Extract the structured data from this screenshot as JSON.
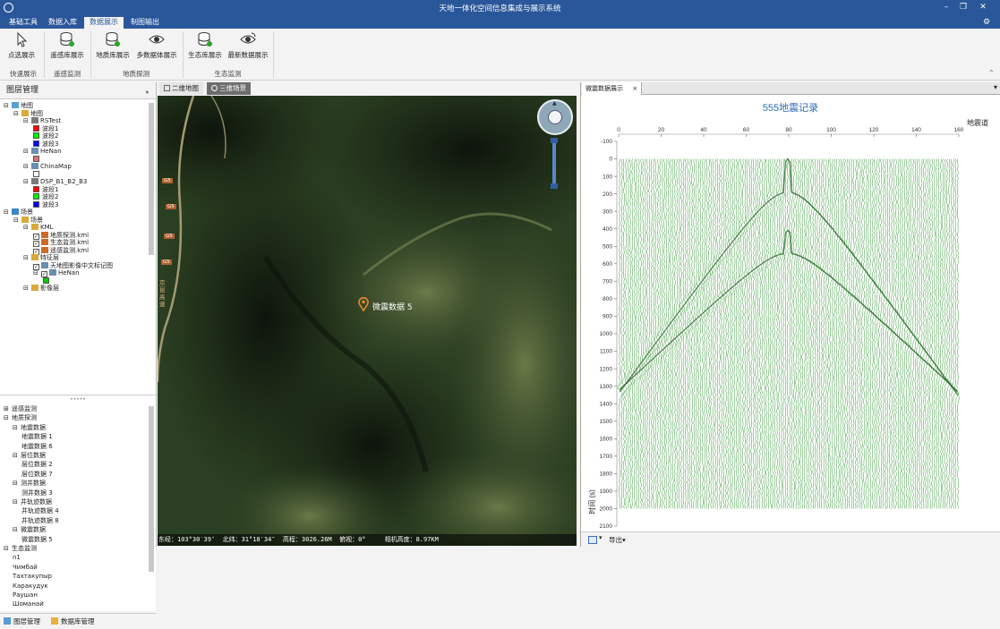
{
  "titlebar": {
    "title": "天地一体化空间信息集成与展示系统"
  },
  "ribbon_tabs": [
    "基础工具",
    "数据入库",
    "数据展示",
    "制图输出"
  ],
  "ribbon": {
    "buttons": [
      "点选展示",
      "遥感库展示",
      "地质库展示",
      "多数据体展示",
      "生态库展示",
      "最新数据展示"
    ],
    "groups": [
      "快速展示",
      "遥感监测",
      "地质探测",
      "生态监测"
    ]
  },
  "left_panel": {
    "title": "图层管理",
    "pin": "ᵩ"
  },
  "layer_tree": [
    {
      "d": 0,
      "exp": "⊟",
      "text": "地图",
      "icon": "map"
    },
    {
      "d": 1,
      "exp": "⊟",
      "text": "地图",
      "icon": "folder"
    },
    {
      "d": 2,
      "exp": "⊟",
      "text": "RSTest",
      "icon": "grid"
    },
    {
      "d": 3,
      "text": "波段1",
      "sw": "#ff0000"
    },
    {
      "d": 3,
      "text": "波段2",
      "sw": "#00ee00"
    },
    {
      "d": 3,
      "text": "波段3",
      "sw": "#0000ff"
    },
    {
      "d": 2,
      "exp": "⊟",
      "text": "HeNan",
      "icon": "vec"
    },
    {
      "d": 3,
      "text": "",
      "sw": "#e07070"
    },
    {
      "d": 2,
      "exp": "⊟",
      "text": "ChinaMap",
      "icon": "vec"
    },
    {
      "d": 3,
      "text": "",
      "sw": "#ffffff"
    },
    {
      "d": 2,
      "exp": "⊟",
      "text": "DSP_B1_B2_B3",
      "icon": "grid"
    },
    {
      "d": 3,
      "text": "波段1",
      "sw": "#ff0000"
    },
    {
      "d": 3,
      "text": "波段2",
      "sw": "#00ee00"
    },
    {
      "d": 3,
      "text": "波段3",
      "sw": "#0000ff"
    },
    {
      "d": 0,
      "exp": "⊟",
      "text": "场景",
      "icon": "globe"
    },
    {
      "d": 1,
      "exp": "⊟",
      "text": "场景",
      "icon": "folder"
    },
    {
      "d": 2,
      "exp": "⊟",
      "text": "KML",
      "icon": "folder"
    },
    {
      "d": 3,
      "chk": true,
      "text": "地质探测.kml",
      "icon": "kml"
    },
    {
      "d": 3,
      "chk": true,
      "text": "生态监测.kml",
      "icon": "kml"
    },
    {
      "d": 3,
      "chk": true,
      "text": "遥感监测.kml",
      "icon": "kml"
    },
    {
      "d": 2,
      "exp": "⊟",
      "text": "特征层",
      "icon": "folder"
    },
    {
      "d": 3,
      "chk": true,
      "text": "天地图影像中文标记图",
      "icon": "vec"
    },
    {
      "d": 3,
      "exp": "⊟",
      "chk": true,
      "text": "HeNan",
      "icon": "vec"
    },
    {
      "d": 4,
      "text": "",
      "sw": "#00cc00"
    },
    {
      "d": 2,
      "exp": "⊟",
      "text": "影像层",
      "icon": "folder"
    }
  ],
  "data_tree": [
    {
      "d": 0,
      "exp": "⊞",
      "text": "遥感监测"
    },
    {
      "d": 0,
      "exp": "⊟",
      "text": "地质探测"
    },
    {
      "d": 1,
      "exp": "⊟",
      "text": "地震数据"
    },
    {
      "d": 2,
      "text": "地震数据 1"
    },
    {
      "d": 2,
      "text": "地震数据 6"
    },
    {
      "d": 1,
      "exp": "⊟",
      "text": "层位数据"
    },
    {
      "d": 2,
      "text": "层位数据 2"
    },
    {
      "d": 2,
      "text": "层位数据 7"
    },
    {
      "d": 1,
      "exp": "⊟",
      "text": "测井数据"
    },
    {
      "d": 2,
      "text": "测井数据 3"
    },
    {
      "d": 1,
      "exp": "⊟",
      "text": "井轨迹数据"
    },
    {
      "d": 2,
      "text": "井轨迹数据 4"
    },
    {
      "d": 2,
      "text": "井轨迹数据 8"
    },
    {
      "d": 1,
      "exp": "⊟",
      "text": "微震数据"
    },
    {
      "d": 2,
      "text": "微震数据 5"
    },
    {
      "d": 0,
      "exp": "⊟",
      "text": "生态监测"
    },
    {
      "d": 1,
      "text": "n1"
    },
    {
      "d": 1,
      "text": "Чимбай"
    },
    {
      "d": 1,
      "text": "Тахтакупыр"
    },
    {
      "d": 1,
      "text": "Каракудук"
    },
    {
      "d": 1,
      "text": "Раушан"
    },
    {
      "d": 1,
      "text": "Шоманай"
    }
  ],
  "left_footer_tabs": [
    "图层管理",
    "数据库管理"
  ],
  "map_tabs": [
    "二维地图",
    "三维场景"
  ],
  "map": {
    "marker_label": "微震数据 5",
    "road_shields": [
      "G5",
      "G5",
      "G5",
      "G5"
    ],
    "road_label": "京昆高速",
    "status": "东经：103°30′39″  北纬：31°18′34″  高程：3026.26M  俯视：0°     相机高度：8.97KM"
  },
  "right_panel": {
    "tab": "微震数据展示",
    "tab_close": "×",
    "dropdown": "▾",
    "export_label": "导出▾",
    "toolbar_icon_arrow": "▾"
  },
  "chart_data": {
    "type": "line",
    "title": "555地震记录",
    "xlabel": "地震道",
    "ylabel": "时间 (s)",
    "xlim": [
      0,
      160
    ],
    "ylim": [
      -100,
      2100
    ],
    "x_ticks": [
      0,
      20,
      40,
      60,
      80,
      100,
      120,
      140,
      160
    ],
    "y_ticks": [
      -100,
      0,
      100,
      200,
      300,
      400,
      500,
      600,
      700,
      800,
      900,
      1000,
      1100,
      1200,
      1300,
      1400,
      1500,
      1600,
      1700,
      1800,
      1900,
      2000,
      2100
    ],
    "traces": 160,
    "time_range": [
      0,
      2000
    ],
    "trace_color": "#1f8c1f",
    "events": [
      {
        "name": "direct-wave",
        "apex_trace": 80,
        "apex_time": 0,
        "edge_time_left": 1350,
        "edge_time_right": 1350
      },
      {
        "name": "reflection",
        "apex_trace": 80,
        "apex_time": 410,
        "edge_time_left": 1330,
        "edge_time_right": 1330
      }
    ]
  }
}
